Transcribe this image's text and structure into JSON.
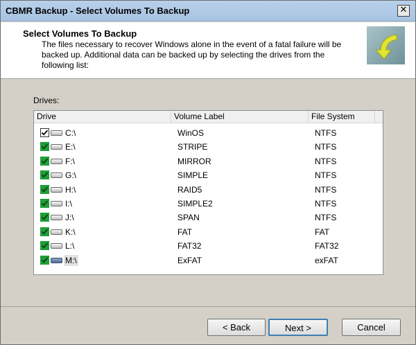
{
  "window": {
    "title": "CBMR Backup - Select Volumes To Backup",
    "close_glyph": "✕"
  },
  "header": {
    "title": "Select Volumes To Backup",
    "description": "The files necessary to recover Windows alone in the event of a fatal failure will be backed up. Additional data can be backed up by selecting the drives from the following list:"
  },
  "drives_label": "Drives:",
  "table": {
    "columns": [
      "Drive",
      "Volume Label",
      "File System"
    ],
    "rows": [
      {
        "drive": "C:\\",
        "label": "WinOS",
        "fs": "NTFS",
        "checked": true,
        "checkbox_style": "black"
      },
      {
        "drive": "E:\\",
        "label": "STRIPE",
        "fs": "NTFS",
        "checked": true,
        "checkbox_style": "green"
      },
      {
        "drive": "F:\\",
        "label": "MIRROR",
        "fs": "NTFS",
        "checked": true,
        "checkbox_style": "green"
      },
      {
        "drive": "G:\\",
        "label": "SIMPLE",
        "fs": "NTFS",
        "checked": true,
        "checkbox_style": "green"
      },
      {
        "drive": "H:\\",
        "label": "RAID5",
        "fs": "NTFS",
        "checked": true,
        "checkbox_style": "green"
      },
      {
        "drive": "I:\\",
        "label": "SIMPLE2",
        "fs": "NTFS",
        "checked": true,
        "checkbox_style": "green"
      },
      {
        "drive": "J:\\",
        "label": "SPAN",
        "fs": "NTFS",
        "checked": true,
        "checkbox_style": "green"
      },
      {
        "drive": "K:\\",
        "label": "FAT",
        "fs": "FAT",
        "checked": true,
        "checkbox_style": "green"
      },
      {
        "drive": "L:\\",
        "label": "FAT32",
        "fs": "FAT32",
        "checked": true,
        "checkbox_style": "green"
      },
      {
        "drive": "M:\\",
        "label": "ExFAT",
        "fs": "exFAT",
        "checked": true,
        "checkbox_style": "green",
        "selected": true
      }
    ]
  },
  "buttons": {
    "back": "< Back",
    "next": "Next >",
    "cancel": "Cancel"
  },
  "colors": {
    "checkbox_green": "#1f9d3a",
    "logo_bg": "#8fb0b6",
    "logo_arrow": "#e0e630",
    "default_button_border": "#3c7fb1"
  },
  "icons": {
    "logo": "arrow-curve-icon",
    "drive": "hard-drive-icon",
    "close": "close-icon"
  }
}
